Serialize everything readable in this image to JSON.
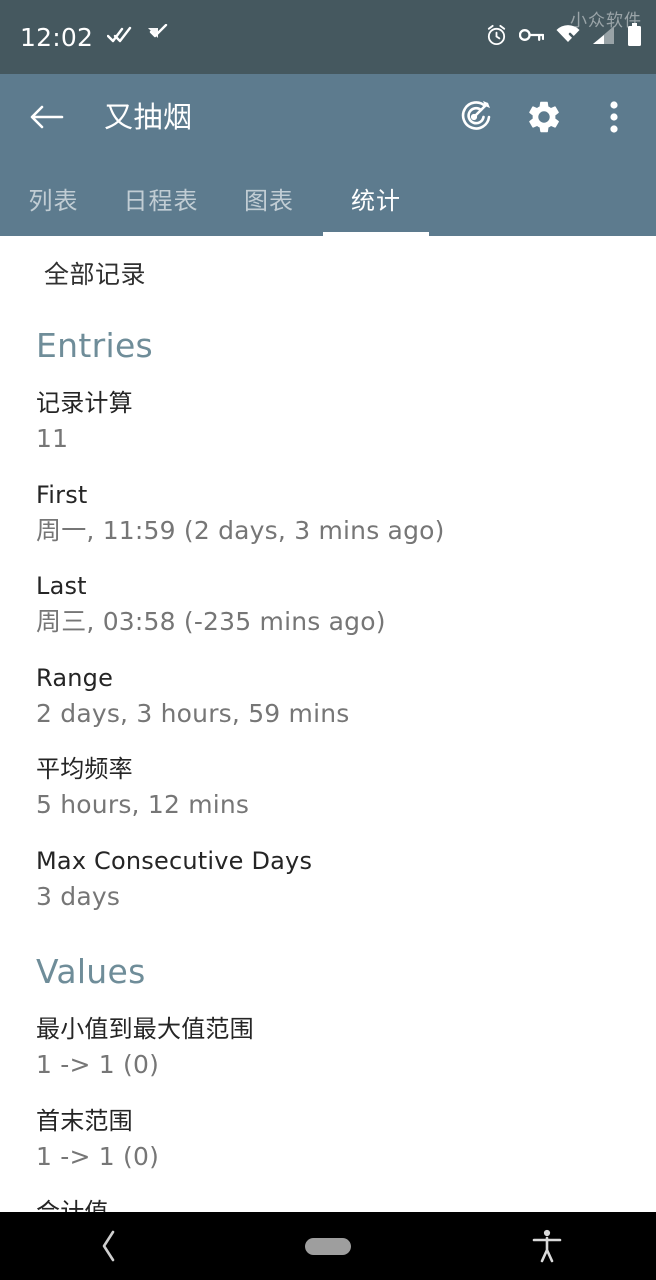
{
  "status_bar": {
    "time": "12:02",
    "watermark": "小众软件",
    "left_icons": [
      "notification-badge-icon",
      "notification-check-icon"
    ],
    "right_icons": [
      "alarm-icon",
      "vpn-key-icon",
      "wifi-off-icon",
      "signal-icon",
      "battery-icon"
    ],
    "background": "#45585f"
  },
  "app_bar": {
    "back_label": "back-arrow",
    "title": "又抽烟",
    "actions": [
      {
        "name": "goal-target-icon",
        "label": "目标"
      },
      {
        "name": "gear-icon",
        "label": "设置"
      },
      {
        "name": "overflow-menu-icon",
        "label": "更多"
      }
    ],
    "background": "#5d7b8e"
  },
  "tabs": {
    "items": [
      {
        "label": "列表",
        "active": false
      },
      {
        "label": "日程表",
        "active": false
      },
      {
        "label": "图表",
        "active": false
      },
      {
        "label": "统计",
        "active": true
      }
    ],
    "indicator_color": "#ffffff"
  },
  "content": {
    "page_header": "全部记录",
    "sections": [
      {
        "title": "Entries",
        "title_color": "#6f8d99",
        "rows": [
          {
            "label": "记录计算",
            "value": "11"
          },
          {
            "label": "First",
            "value": "周一, 11:59 (2 days, 3 mins ago)"
          },
          {
            "label": "Last",
            "value": "周三, 03:58 (-235 mins ago)"
          },
          {
            "label": "Range",
            "value": "2 days, 3 hours, 59 mins"
          },
          {
            "label": "平均频率",
            "value": "5 hours, 12 mins"
          },
          {
            "label": "Max Consecutive Days",
            "value": "3 days"
          }
        ]
      },
      {
        "title": "Values",
        "title_color": "#6f8d99",
        "rows": [
          {
            "label": "最小值到最大值范围",
            "value": "1 -> 1 (0)"
          },
          {
            "label": "首末范围",
            "value": "1 -> 1 (0)"
          },
          {
            "label": "合计值",
            "value": ""
          }
        ]
      }
    ]
  },
  "nav_bar": {
    "back": "back-chevron-icon",
    "home": "home-pill-icon",
    "accessibility": "accessibility-icon",
    "background": "#000000"
  }
}
